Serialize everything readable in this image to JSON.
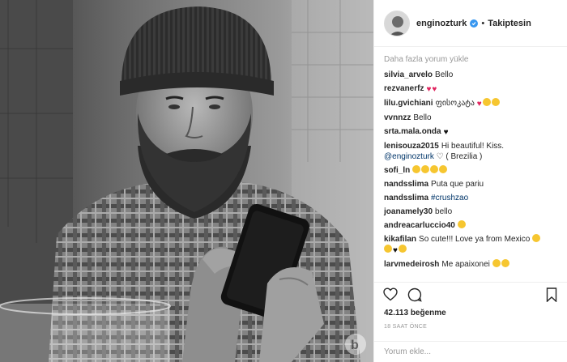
{
  "header": {
    "username": "enginozturk",
    "follow_state": "Takiptesin",
    "separator": "•"
  },
  "comments": {
    "load_more": "Daha fazla yorum yükle",
    "items": [
      {
        "user": "silvia_arvelo",
        "text": "Bello",
        "emojis": []
      },
      {
        "user": "rezvanerfz",
        "text": "",
        "emojis": [
          "heart-red",
          "heart-red"
        ]
      },
      {
        "user": "lilu.gvichiani",
        "text": "ფისოკატა",
        "emojis": [
          "heart-red",
          "yel",
          "yel"
        ]
      },
      {
        "user": "vvnnzz",
        "text": "Bello",
        "emojis": []
      },
      {
        "user": "srta.mala.onda",
        "text": "",
        "emojis": [
          "heart-black"
        ]
      },
      {
        "user": "lenisouza2015",
        "text": "Hi beautiful! Kiss.",
        "line2_tag": "@enginozturk",
        "line2_text": " ♡ ( Brezilia )",
        "emojis": []
      },
      {
        "user": "sofi_ln",
        "text": "",
        "emojis": [
          "yel",
          "yel",
          "yel",
          "yel"
        ]
      },
      {
        "user": "nandsslima",
        "text": "Puta que pariu",
        "emojis": []
      },
      {
        "user": "nandsslima",
        "text": "",
        "tag": "#crushzao",
        "emojis": []
      },
      {
        "user": "joanamely30",
        "text": "bello",
        "emojis": []
      },
      {
        "user": "andreacarluccio40",
        "text": "",
        "emojis": [
          "yel"
        ]
      },
      {
        "user": "kikafilan",
        "text": "So cute!!! Love ya from Mexico",
        "emojis": [
          "yel"
        ],
        "line2_emojis": [
          "yel",
          "heart-black",
          "yel"
        ]
      },
      {
        "user": "larvmedeirosh",
        "text": "Me apaixonei",
        "emojis": [
          "yel",
          "yel"
        ]
      }
    ]
  },
  "stats": {
    "likes": "42.113 beğenme",
    "time_ago": "18 SAAT ÖNCE"
  },
  "add_comment": {
    "placeholder": "Yorum ekle..."
  },
  "icons": {
    "like": "heart-outline-icon",
    "comment": "comment-bubble-icon",
    "save": "bookmark-icon",
    "verified": "verified-badge-icon",
    "watermark": "b-logo-watermark"
  },
  "colors": {
    "verified": "#3897f0",
    "text": "#262626",
    "muted": "#999999",
    "tag": "#003569"
  }
}
